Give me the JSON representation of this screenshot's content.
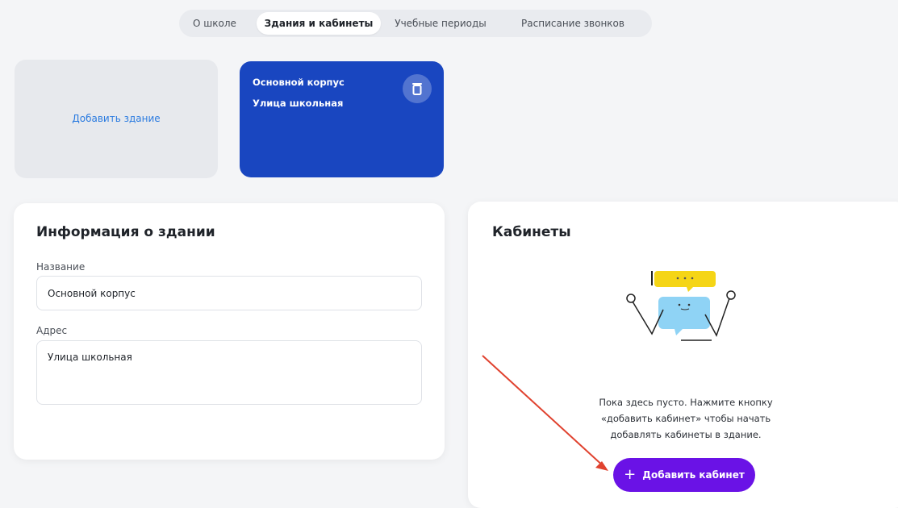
{
  "tabs": [
    {
      "label": "О школе",
      "active": false
    },
    {
      "label": "Здания и кабинеты",
      "active": true
    },
    {
      "label": "Учебные периоды",
      "active": false
    },
    {
      "label": "Расписание звонков",
      "active": false
    }
  ],
  "buildings": {
    "add_label": "Добавить здание",
    "card": {
      "name": "Основной корпус",
      "address": "Улица школьная",
      "icon": "trash-icon"
    }
  },
  "info": {
    "title": "Информация о здании",
    "name_label": "Название",
    "name_value": "Основной корпус",
    "address_label": "Адрес",
    "address_value": "Улица школьная"
  },
  "rooms": {
    "title": "Кабинеты",
    "empty_lines": [
      "Пока здесь пусто. Нажмите кнопку",
      "«добавить кабинет» чтобы начать",
      "добавлять кабинеты в здание."
    ],
    "add_button": "Добавить кабинет",
    "add_icon": "plus-icon"
  },
  "colors": {
    "accent_blue": "#1946c0",
    "button_purple": "#6a12e6",
    "link_blue": "#2b7be0",
    "annotation_red": "#e0422f"
  }
}
